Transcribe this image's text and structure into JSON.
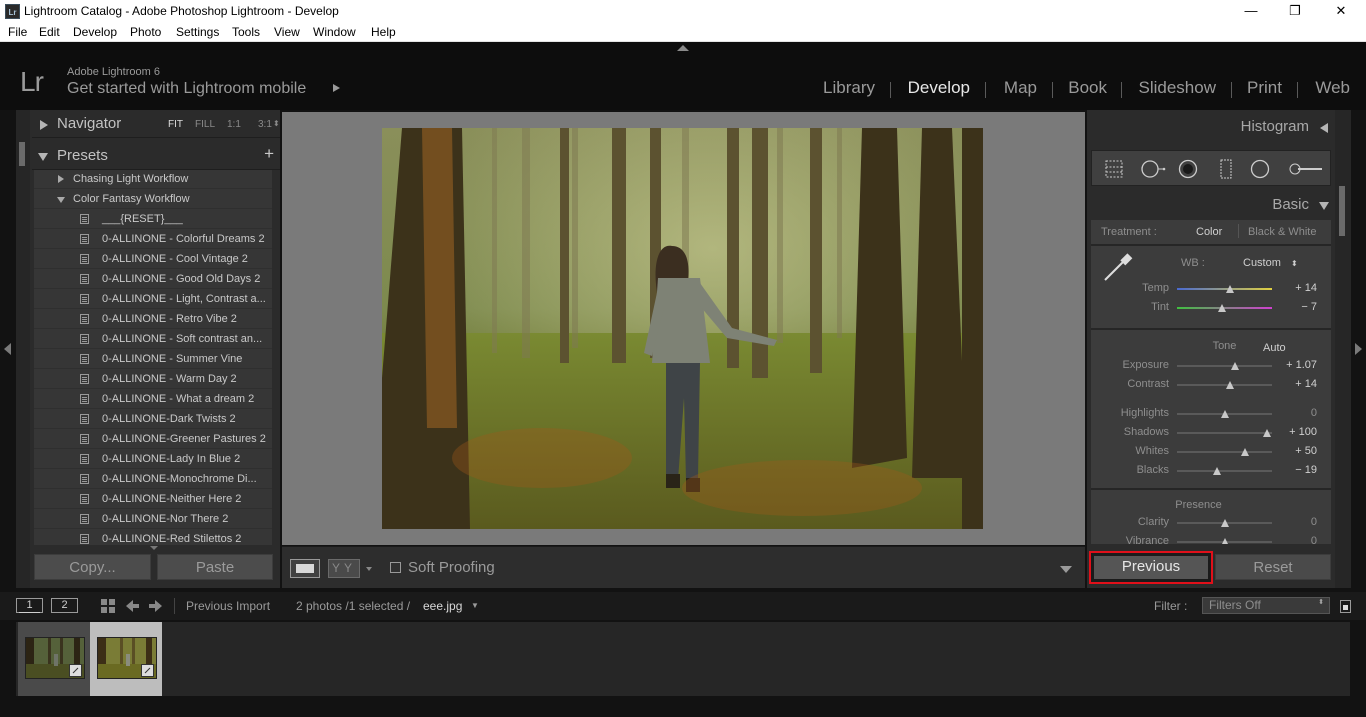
{
  "window": {
    "badge": "Lr",
    "title": "Lightroom Catalog - Adobe Photoshop Lightroom - Develop",
    "minimize": "—",
    "maximize": "❐",
    "close": "✕"
  },
  "menu": [
    "File",
    "Edit",
    "Develop",
    "Photo",
    "Settings",
    "Tools",
    "View",
    "Window",
    "Help"
  ],
  "identity": {
    "logo": "Lr",
    "product": "Adobe Lightroom 6",
    "mobile_prompt": "Get started with Lightroom mobile"
  },
  "modules": {
    "items": [
      "Library",
      "Develop",
      "Map",
      "Book",
      "Slideshow",
      "Print",
      "Web"
    ],
    "active": "Develop"
  },
  "left_panel": {
    "navigator": {
      "label": "Navigator",
      "options": [
        "FIT",
        "FILL",
        "1:1",
        "3:1"
      ],
      "options_extra": "⬍",
      "active": "FIT"
    },
    "presets": {
      "label": "Presets",
      "add": "+",
      "items": [
        {
          "label": "Chasing Light Workflow",
          "kind": "folder",
          "expanded": false
        },
        {
          "label": "Color Fantasy Workflow",
          "kind": "folder",
          "expanded": true
        },
        {
          "label": "___{RESET}___",
          "kind": "preset"
        },
        {
          "label": "0-ALLINONE - Colorful Dreams 2",
          "kind": "preset"
        },
        {
          "label": "0-ALLINONE - Cool Vintage 2",
          "kind": "preset"
        },
        {
          "label": "0-ALLINONE - Good Old Days 2",
          "kind": "preset"
        },
        {
          "label": "0-ALLINONE - Light, Contrast a...",
          "kind": "preset"
        },
        {
          "label": "0-ALLINONE - Retro Vibe 2",
          "kind": "preset"
        },
        {
          "label": "0-ALLINONE - Soft contrast an...",
          "kind": "preset"
        },
        {
          "label": "0-ALLINONE - Summer Vine",
          "kind": "preset"
        },
        {
          "label": "0-ALLINONE - Warm Day 2",
          "kind": "preset"
        },
        {
          "label": "0-ALLINONE - What a dream 2",
          "kind": "preset"
        },
        {
          "label": "0-ALLINONE-Dark Twists 2",
          "kind": "preset"
        },
        {
          "label": "0-ALLINONE-Greener Pastures 2",
          "kind": "preset"
        },
        {
          "label": "0-ALLINONE-Lady In Blue 2",
          "kind": "preset"
        },
        {
          "label": "0-ALLINONE-Monochrome Di...",
          "kind": "preset"
        },
        {
          "label": "0-ALLINONE-Neither Here 2",
          "kind": "preset"
        },
        {
          "label": "0-ALLINONE-Nor There 2",
          "kind": "preset"
        },
        {
          "label": "0-ALLINONE-Red Stilettos 2",
          "kind": "preset"
        }
      ]
    },
    "copy_label": "Copy...",
    "paste_label": "Paste"
  },
  "toolbar": {
    "yy": "YY",
    "soft_proofing": "Soft Proofing",
    "soft_proofing_checked": false
  },
  "right_panel": {
    "histogram_label": "Histogram",
    "basic_label": "Basic",
    "treatment": {
      "label": "Treatment :",
      "options": [
        "Color",
        "Black & White"
      ],
      "active": "Color"
    },
    "wb": {
      "label": "WB :",
      "value": "Custom",
      "arrows": "⬍"
    },
    "tone_label": "Tone",
    "auto_label": "Auto",
    "presence_label": "Presence",
    "sliders": [
      {
        "label": "Temp",
        "value": "+ 14",
        "position": 0.56,
        "gradient": "temp"
      },
      {
        "label": "Tint",
        "value": "− 7",
        "position": 0.47,
        "gradient": "tint"
      },
      {
        "label": "Exposure",
        "value": "+ 1.07",
        "position": 0.61,
        "gradient": "none"
      },
      {
        "label": "Contrast",
        "value": "+ 14",
        "position": 0.56,
        "gradient": "none"
      },
      {
        "label": "Highlights",
        "value": "0",
        "position": 0.5,
        "gradient": "none"
      },
      {
        "label": "Shadows",
        "value": "+ 100",
        "position": 0.95,
        "gradient": "none"
      },
      {
        "label": "Whites",
        "value": "+ 50",
        "position": 0.72,
        "gradient": "none"
      },
      {
        "label": "Blacks",
        "value": "− 19",
        "position": 0.42,
        "gradient": "none"
      },
      {
        "label": "Clarity",
        "value": "0",
        "position": 0.5,
        "gradient": "none"
      },
      {
        "label": "Vibrance",
        "value": "0",
        "position": 0.5,
        "gradient": "none"
      }
    ],
    "previous_label": "Previous",
    "reset_label": "Reset"
  },
  "filmstrip_bar": {
    "screen1": "1",
    "screen2": "2",
    "source": "Previous Import",
    "count": "2 photos /1 selected /",
    "filename": "eee.jpg",
    "filename_dd": "▼",
    "filter_label": "Filter :",
    "filter_value": "Filters Off",
    "filter_arrows": "⬍"
  },
  "colors": {
    "panel": "#2b2b2b",
    "accent_highlight": "#e0101a",
    "text_active": "#e8e8e8",
    "text_dim": "#9a9a9a"
  }
}
